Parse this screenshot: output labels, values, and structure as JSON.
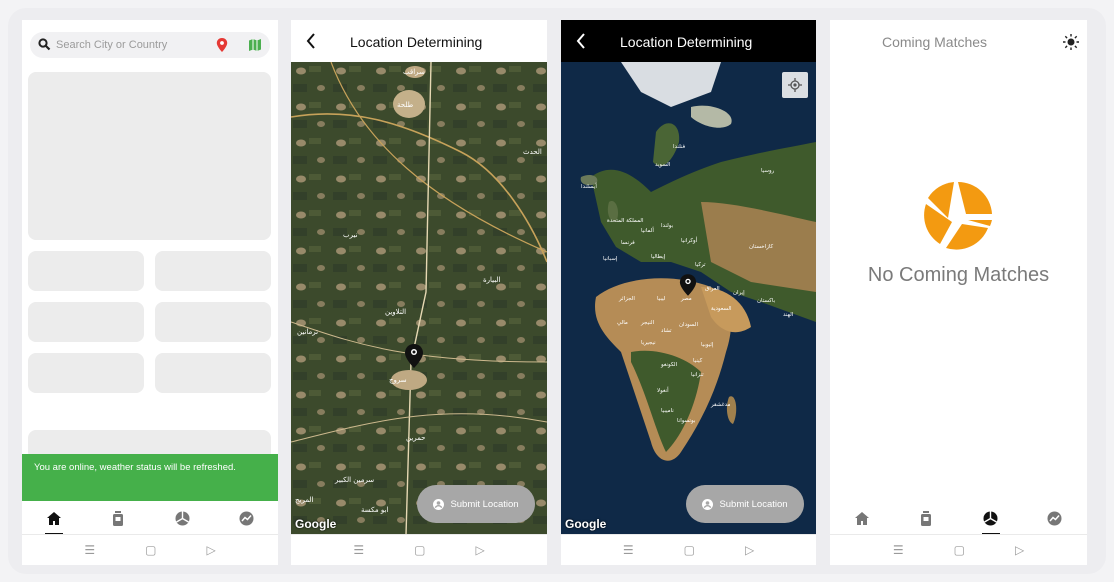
{
  "screen1": {
    "search_placeholder": "Search City or Country",
    "toast": "You are online, weather status will be refreshed.",
    "tabs": [
      "home-icon",
      "jersey-icon",
      "ball-icon",
      "chart-icon"
    ],
    "active_tab": 0
  },
  "screen2": {
    "title": "Location Determining",
    "submit_label": "Submit Location",
    "map_attribution": "Google",
    "map_labels": [
      "سراقب",
      "طلحة",
      "الحدث",
      "نيرب",
      "البيارة",
      "التلاوين",
      "ترمانين",
      "سروج",
      "حمرين",
      "سرمين الكبير",
      "ابو مكسة",
      "المريح"
    ]
  },
  "screen3": {
    "title": "Location Determining",
    "submit_label": "Submit Location",
    "map_attribution": "Google",
    "map_labels": [
      "أيسلندا",
      "السويد",
      "فنلندا",
      "روسيا",
      "المملكة المتحدة",
      "ألمانيا",
      "بولندا",
      "أوكرانيا",
      "فرنسا",
      "إسبانيا",
      "إيطاليا",
      "تركيا",
      "كازاخستان",
      "الجزائر",
      "ليبيا",
      "مصر",
      "العراق",
      "إيران",
      "السعودية",
      "باكستان",
      "الهند",
      "مالي",
      "النيجر",
      "تشاد",
      "السودان",
      "إثيوبيا",
      "نيجيريا",
      "الكونغو",
      "كينيا",
      "أنغولا",
      "تنزانيا",
      "ناميبيا",
      "بوتسوانا",
      "مدغشقر"
    ]
  },
  "screen4": {
    "title": "Coming Matches",
    "empty_message": "No Coming Matches",
    "accent": "#f39a11",
    "active_tab": 2
  },
  "sysnav": [
    "☰",
    "▢",
    "▷"
  ]
}
